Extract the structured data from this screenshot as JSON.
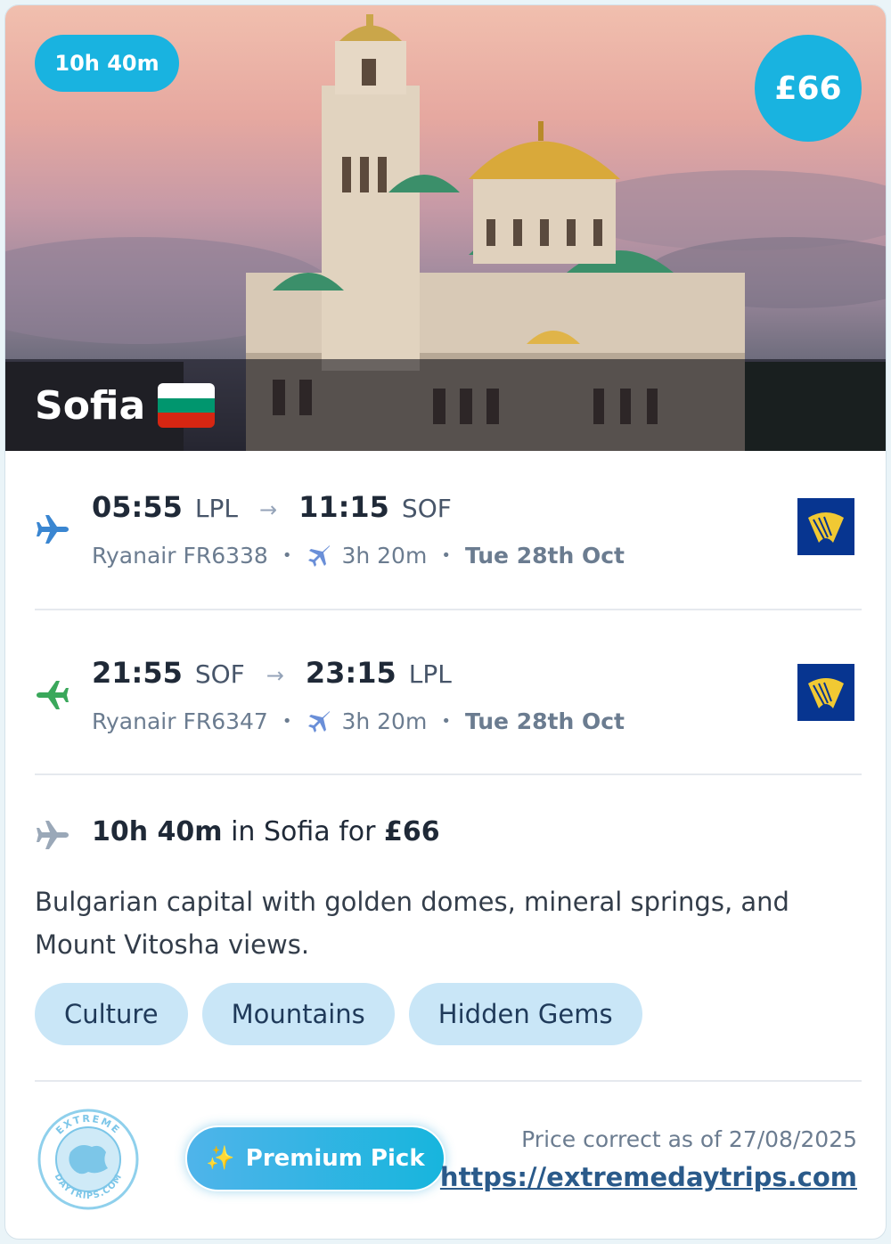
{
  "hero": {
    "duration_badge": "10h 40m",
    "price_badge": "£66",
    "city": "Sofia",
    "flag_colors": [
      "#ffffff",
      "#00966e",
      "#d62612"
    ]
  },
  "outbound": {
    "depart_time": "05:55",
    "depart_code": "LPL",
    "arrow": "→",
    "arrive_time": "11:15",
    "arrive_code": "SOF",
    "airline_flight": "Ryanair FR6338",
    "duration": "3h 20m",
    "date": "Tue 28th Oct",
    "icon": "plane-icon",
    "icon_color": "#3a86d1"
  },
  "return": {
    "depart_time": "21:55",
    "depart_code": "SOF",
    "arrow": "→",
    "arrive_time": "23:15",
    "arrive_code": "LPL",
    "airline_flight": "Ryanair FR6347",
    "duration": "3h 20m",
    "date": "Tue 28th Oct",
    "icon": "plane-icon",
    "icon_color": "#3aa85b"
  },
  "summary": {
    "duration": "10h 40m",
    "middle": " in Sofia for ",
    "price": "£66"
  },
  "description": "Bulgarian capital with golden domes, mineral springs, and Mount Vitosha views.",
  "tags": [
    "Culture",
    "Mountains",
    "Hidden Gems"
  ],
  "footer": {
    "badge_label": "Premium Pick",
    "badge_icon": "✨",
    "price_note": "Price correct as of 27/08/2025",
    "site": "https://extremedaytrips.com",
    "logo_text_top": "EXTREME",
    "logo_text_bottom": "DAYTRIPS.COM"
  },
  "colors": {
    "accent": "#19b3e0",
    "tag_bg": "#c9e6f7",
    "ryanair_blue": "#073590",
    "ryanair_yellow": "#f1c933"
  }
}
